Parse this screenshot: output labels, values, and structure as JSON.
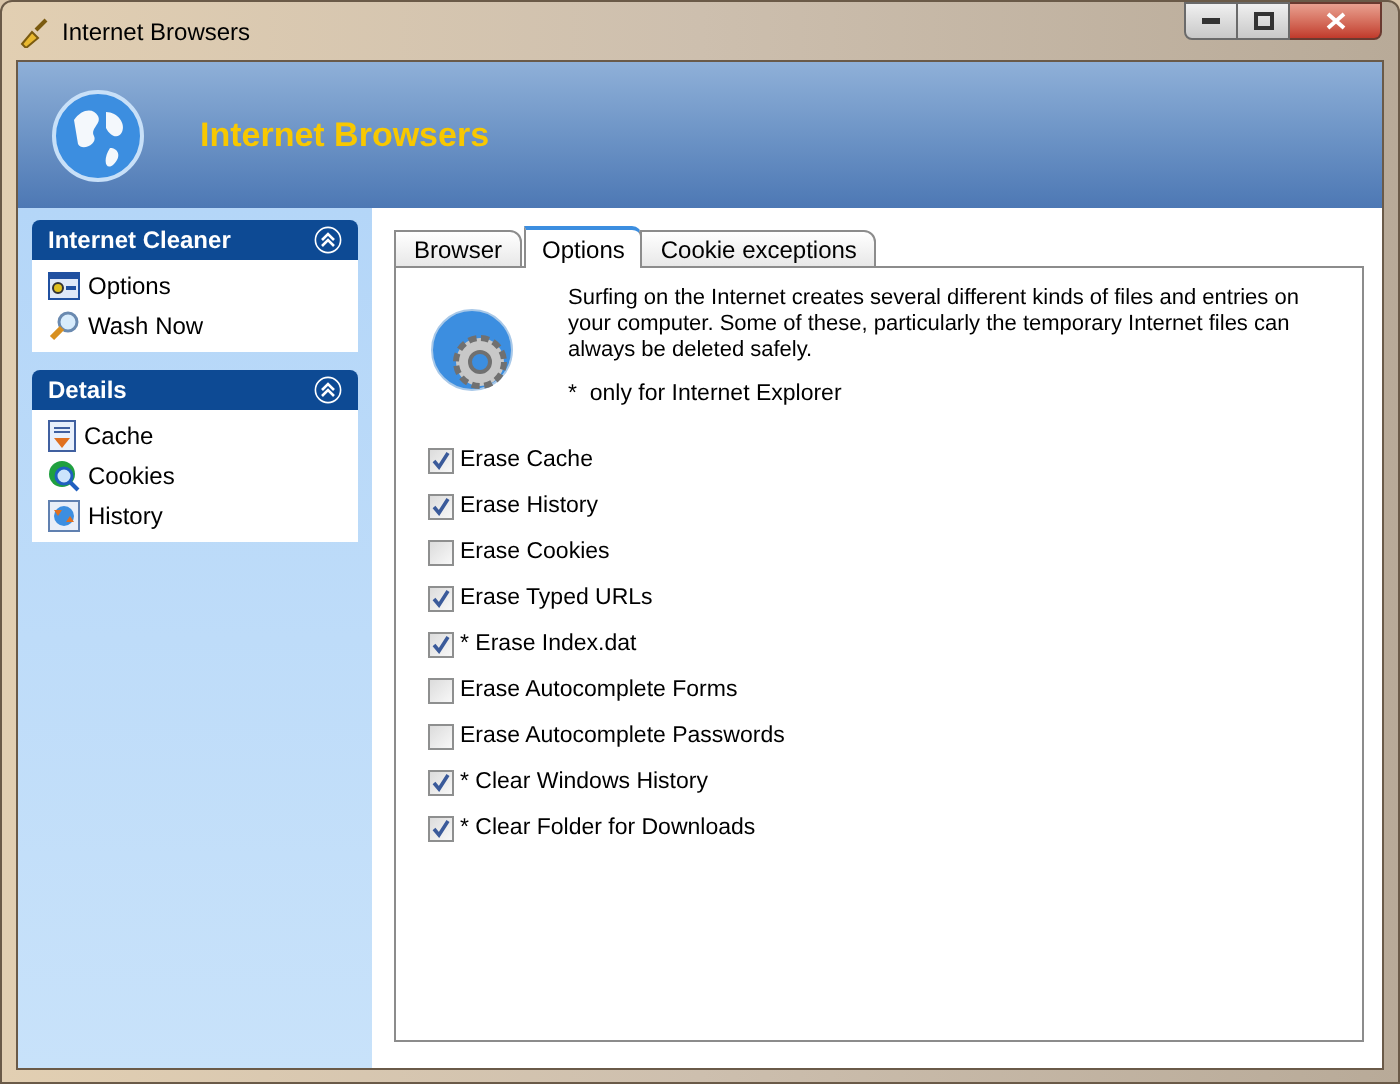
{
  "window": {
    "title": "Internet Browsers"
  },
  "header": {
    "title": "Internet Browsers"
  },
  "sidebar": {
    "groups": [
      {
        "title": "Internet Cleaner",
        "expanded": true,
        "items": [
          {
            "label": "Options"
          },
          {
            "label": "Wash Now"
          }
        ]
      },
      {
        "title": "Details",
        "expanded": true,
        "items": [
          {
            "label": "Cache"
          },
          {
            "label": "Cookies"
          },
          {
            "label": "History"
          }
        ]
      }
    ]
  },
  "tabs": [
    {
      "label": "Browser",
      "selected": false
    },
    {
      "label": "Options",
      "selected": true
    },
    {
      "label": "Cookie exceptions",
      "selected": false
    }
  ],
  "description": "Surfing on the Internet creates several different kinds of files and entries on your computer. Some of these, particularly the temporary Internet files can always be deleted safely.",
  "note": "*  only for Internet Explorer",
  "options": [
    {
      "label": "Erase Cache",
      "checked": true
    },
    {
      "label": "Erase History",
      "checked": true
    },
    {
      "label": "Erase Cookies",
      "checked": false
    },
    {
      "label": "Erase Typed URLs",
      "checked": true
    },
    {
      "label": "* Erase Index.dat",
      "checked": true
    },
    {
      "label": "Erase Autocomplete Forms",
      "checked": false
    },
    {
      "label": "Erase Autocomplete Passwords",
      "checked": false
    },
    {
      "label": "* Clear Windows History",
      "checked": true
    },
    {
      "label": "* Clear Folder for Downloads",
      "checked": true
    }
  ]
}
